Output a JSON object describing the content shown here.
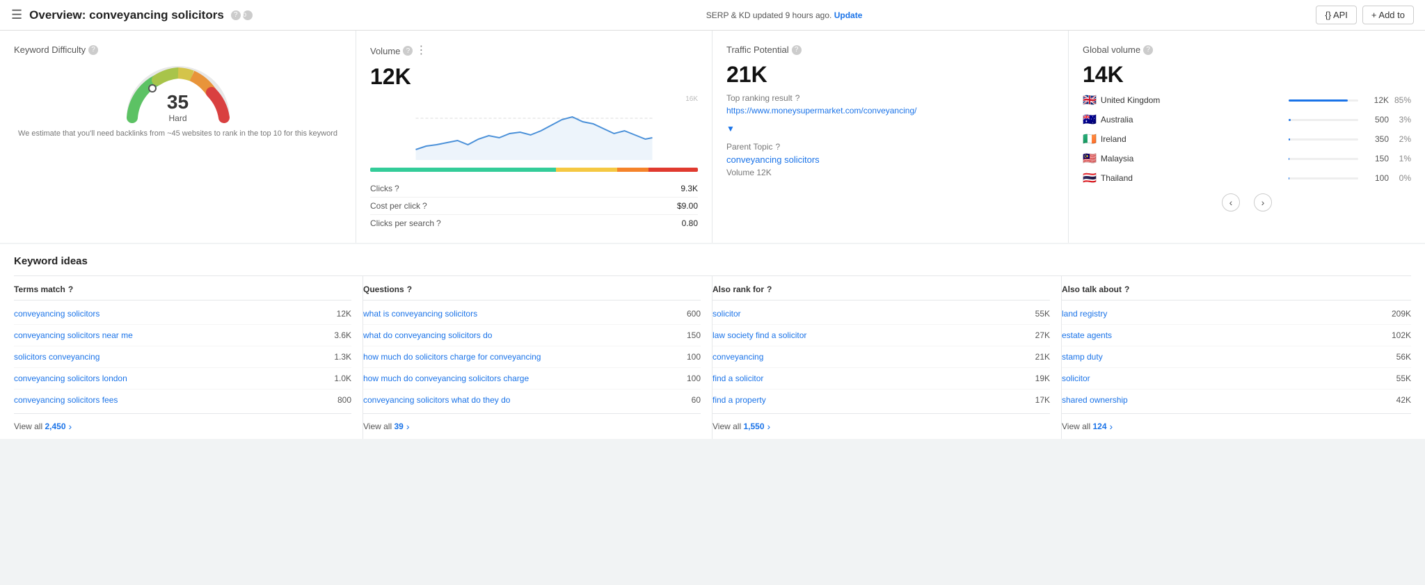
{
  "topbar": {
    "title": "Overview: conveyancing solicitors",
    "howto": "How to use",
    "update_text": "SERP & KD updated 9 hours ago.",
    "update_link": "Update",
    "api_label": "{} API",
    "addto_label": "+ Add to"
  },
  "kd_panel": {
    "title": "Keyword Difficulty",
    "score": "35",
    "label": "Hard",
    "description": "We estimate that you'll need backlinks from ~45 websites to rank in the top 10 for this keyword"
  },
  "volume_panel": {
    "title": "Volume",
    "value": "12K",
    "chart_top_label": "16K",
    "stats": [
      {
        "label": "Clicks",
        "value": "9.3K"
      },
      {
        "label": "Cost per click",
        "value": "$9.00"
      },
      {
        "label": "Clicks per search",
        "value": "0.80"
      }
    ]
  },
  "traffic_panel": {
    "title": "Traffic Potential",
    "value": "21K",
    "rank_label": "Top ranking result",
    "url": "https://www.moneysupermarket.com/conveyancing/",
    "parent_label": "Parent Topic",
    "parent_link": "conveyancing solicitors",
    "parent_volume": "Volume 12K"
  },
  "global_panel": {
    "title": "Global volume",
    "value": "14K",
    "countries": [
      {
        "flag": "🇬🇧",
        "name": "United Kingdom",
        "volume": "12K",
        "pct": "85%",
        "bar_pct": 85
      },
      {
        "flag": "🇦🇺",
        "name": "Australia",
        "volume": "500",
        "pct": "3%",
        "bar_pct": 3
      },
      {
        "flag": "🇮🇪",
        "name": "Ireland",
        "volume": "350",
        "pct": "2%",
        "bar_pct": 2
      },
      {
        "flag": "🇲🇾",
        "name": "Malaysia",
        "volume": "150",
        "pct": "1%",
        "bar_pct": 1
      },
      {
        "flag": "🇹🇭",
        "name": "Thailand",
        "volume": "100",
        "pct": "0%",
        "bar_pct": 0.5
      }
    ]
  },
  "keyword_ideas": {
    "section_title": "Keyword ideas",
    "columns": [
      {
        "header": "Terms match",
        "items": [
          {
            "text": "conveyancing solicitors",
            "volume": "12K"
          },
          {
            "text": "conveyancing solicitors near me",
            "volume": "3.6K"
          },
          {
            "text": "solicitors conveyancing",
            "volume": "1.3K"
          },
          {
            "text": "conveyancing solicitors london",
            "volume": "1.0K"
          },
          {
            "text": "conveyancing solicitors fees",
            "volume": "800"
          }
        ],
        "view_all": "View all",
        "view_all_num": "2,450"
      },
      {
        "header": "Questions",
        "items": [
          {
            "text": "what is conveyancing solicitors",
            "volume": "600"
          },
          {
            "text": "what do conveyancing solicitors do",
            "volume": "150"
          },
          {
            "text": "how much do solicitors charge for conveyancing",
            "volume": "100"
          },
          {
            "text": "how much do conveyancing solicitors charge",
            "volume": "100"
          },
          {
            "text": "conveyancing solicitors what do they do",
            "volume": "60"
          }
        ],
        "view_all": "View all",
        "view_all_num": "39"
      },
      {
        "header": "Also rank for",
        "items": [
          {
            "text": "solicitor",
            "volume": "55K"
          },
          {
            "text": "law society find a solicitor",
            "volume": "27K"
          },
          {
            "text": "conveyancing",
            "volume": "21K"
          },
          {
            "text": "find a solicitor",
            "volume": "19K"
          },
          {
            "text": "find a property",
            "volume": "17K"
          }
        ],
        "view_all": "View all",
        "view_all_num": "1,550"
      },
      {
        "header": "Also talk about",
        "items": [
          {
            "text": "land registry",
            "volume": "209K"
          },
          {
            "text": "estate agents",
            "volume": "102K"
          },
          {
            "text": "stamp duty",
            "volume": "56K"
          },
          {
            "text": "solicitor",
            "volume": "55K"
          },
          {
            "text": "shared ownership",
            "volume": "42K"
          }
        ],
        "view_all": "View all",
        "view_all_num": "124"
      }
    ]
  }
}
